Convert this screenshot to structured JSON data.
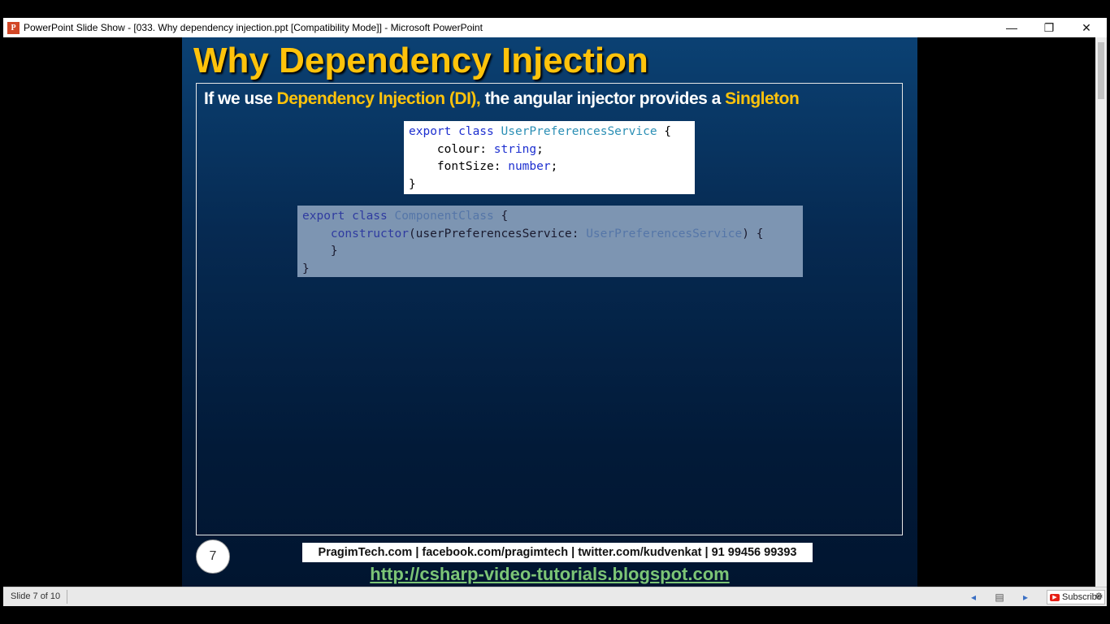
{
  "window": {
    "title": "PowerPoint Slide Show - [033. Why dependency injection.ppt [Compatibility Mode]] - Microsoft PowerPoint",
    "app_icon_letter": "P",
    "minimize_glyph": "—",
    "maximize_glyph": "❐",
    "close_glyph": "✕"
  },
  "slide": {
    "title": "Why Dependency Injection",
    "subtitle": {
      "part1": "If we use ",
      "highlight1": "Dependency Injection (DI),",
      "part2": " the angular injector provides a ",
      "highlight2": "Singleton"
    },
    "code1": {
      "l1_kw": "export class",
      "l1_type": "UserPreferencesService",
      "l1_end": " {",
      "l2_name": "    colour: ",
      "l2_type": "string",
      "l2_end": ";",
      "l3_name": "    fontSize: ",
      "l3_type": "number",
      "l3_end": ";",
      "l4": "}"
    },
    "code2": {
      "l1_kw": "export class",
      "l1_type": "ComponentClass",
      "l1_end": " {",
      "l2_indent": "    ",
      "l2_kw": "constructor",
      "l2_param": "(userPreferencesService: ",
      "l2_type": "UserPreferencesService",
      "l2_end": ") {",
      "l3": "    }",
      "l4": "}"
    },
    "number": "7",
    "footer_contacts": "PragimTech.com | facebook.com/pragimtech  | twitter.com/kudvenkat  | 91 99456 99393",
    "footer_url": "http://csharp-video-tutorials.blogspot.com"
  },
  "statusbar": {
    "slide_counter": "Slide 7 of 10",
    "prev_glyph": "◂",
    "menu_glyph": "▤",
    "next_glyph": "▸",
    "subscribe_label": "Subscribe",
    "settings_glyph": "⚙"
  }
}
